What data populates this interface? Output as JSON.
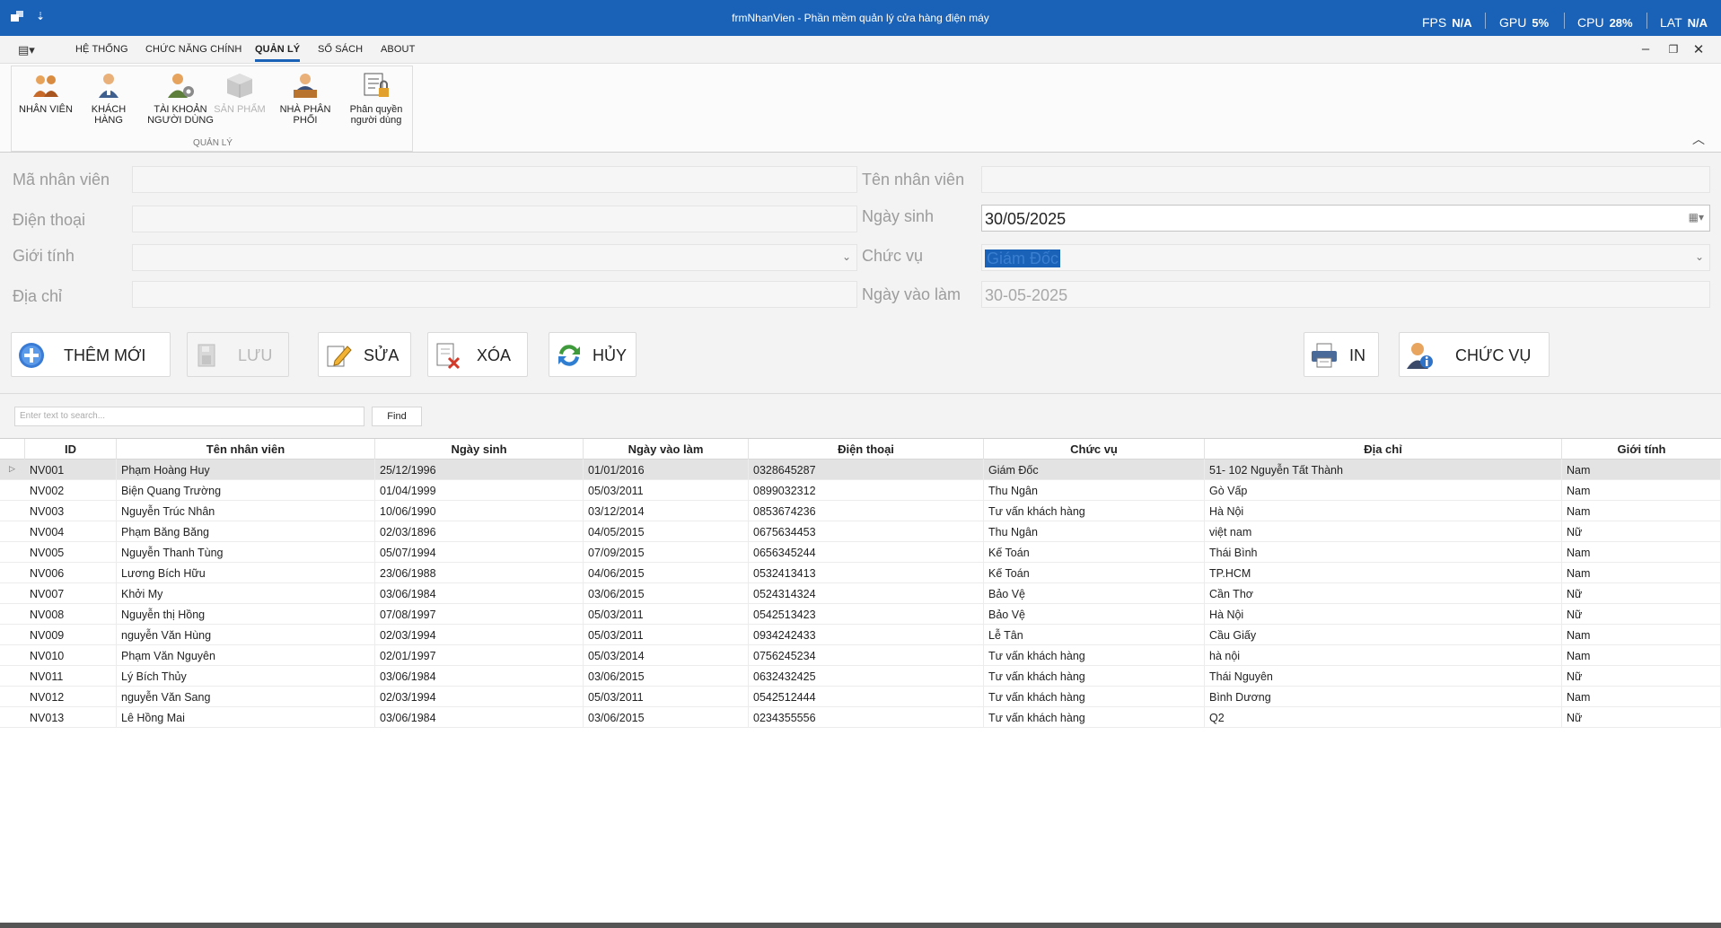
{
  "window": {
    "title": "frmNhanVien - Phần mềm quản lý cửa hàng điện máy",
    "qat_symbol": "⇣"
  },
  "perf": {
    "fps_label": "FPS",
    "fps_value": "N/A",
    "gpu_label": "GPU",
    "gpu_value": "5%",
    "cpu_label": "CPU",
    "cpu_value": "28%",
    "lat_label": "LAT",
    "lat_value": "N/A"
  },
  "menu": {
    "tabs": [
      "HỆ THỐNG",
      "CHỨC NĂNG CHÍNH",
      "QUẢN LÝ",
      "SỔ SÁCH",
      "ABOUT"
    ],
    "active_tab": "QUẢN LÝ"
  },
  "ribbon": {
    "group_label": "QUẢN LÝ",
    "buttons": [
      {
        "label": "NHÂN VIÊN",
        "icon": "staff-group-icon"
      },
      {
        "label": "KHÁCH HÀNG",
        "icon": "customer-icon"
      },
      {
        "label": "TÀI KHOẢN NGƯỜI DÙNG",
        "icon": "user-account-icon"
      },
      {
        "label": "SẢN PHẨM",
        "icon": "product-box-icon",
        "disabled": true
      },
      {
        "label": "NHÀ PHÂN PHỐI",
        "icon": "distributor-icon"
      },
      {
        "label": "Phân quyền người dùng",
        "icon": "permission-icon"
      }
    ]
  },
  "form": {
    "ma_nv_label": "Mã nhân viên",
    "ten_nv_label": "Tên nhân viên",
    "dien_thoai_label": "Điện thoại",
    "ngay_sinh_label": "Ngày sinh",
    "ngay_sinh_value": "30/05/2025",
    "gioi_tinh_label": "Giới tính",
    "chuc_vu_label": "Chức vụ",
    "chuc_vu_value": "Giám Đốc",
    "dia_chi_label": "Địa chỉ",
    "ngay_vao_lam_label": "Ngày vào làm",
    "ngay_vao_lam_value": "30-05-2025"
  },
  "actions": {
    "them_moi": "THÊM MỚI",
    "luu": "LƯU",
    "sua": "SỬA",
    "xoa": "XÓA",
    "huy": "HỦY",
    "in": "IN",
    "chuc_vu": "CHỨC VỤ"
  },
  "find": {
    "placeholder": "Enter text to search...",
    "button": "Find"
  },
  "grid": {
    "columns": [
      "ID",
      "Tên nhân viên",
      "Ngày sinh",
      "Ngày vào làm",
      "Điện thoại",
      "Chức vụ",
      "Địa chỉ",
      "Giới tính"
    ],
    "rows": [
      [
        "NV001",
        "Phạm Hoàng Huy",
        "25/12/1996",
        "01/01/2016",
        "0328645287",
        "Giám Đốc",
        "51- 102 Nguyễn Tất Thành",
        "Nam"
      ],
      [
        "NV002",
        "Biện Quang Trường",
        "01/04/1999",
        "05/03/2011",
        "0899032312",
        "Thu Ngân",
        "Gò Vấp",
        "Nam"
      ],
      [
        "NV003",
        "Nguyễn Trúc Nhân",
        "10/06/1990",
        "03/12/2014",
        "0853674236",
        "Tư vấn khách hàng",
        "Hà Nội",
        "Nam"
      ],
      [
        "NV004",
        "Phạm Băng Băng",
        "02/03/1896",
        "04/05/2015",
        "0675634453",
        "Thu Ngân",
        "việt nam",
        "Nữ"
      ],
      [
        "NV005",
        "Nguyễn Thanh Tùng",
        "05/07/1994",
        "07/09/2015",
        "0656345244",
        "Kế Toán",
        "Thái Bình",
        "Nam"
      ],
      [
        "NV006",
        "Lương Bích Hữu",
        "23/06/1988",
        "04/06/2015",
        "0532413413",
        "Kế Toán",
        "TP.HCM",
        "Nam"
      ],
      [
        "NV007",
        "Khởi My",
        "03/06/1984",
        "03/06/2015",
        "0524314324",
        "Bảo Vệ",
        "Cần Thơ",
        "Nữ"
      ],
      [
        "NV008",
        "Nguyễn thị Hồng",
        "07/08/1997",
        "05/03/2011",
        "0542513423",
        "Bảo Vệ",
        "Hà Nội",
        "Nữ"
      ],
      [
        "NV009",
        "nguyễn Văn Hùng",
        "02/03/1994",
        "05/03/2011",
        "0934242433",
        "Lễ Tân",
        "Cầu Giấy",
        "Nam"
      ],
      [
        "NV010",
        "Phạm Văn Nguyên",
        "02/01/1997",
        "05/03/2014",
        "0756245234",
        "Tư vấn khách hàng",
        "hà nội",
        "Nam"
      ],
      [
        "NV011",
        "Lý Bích Thủy",
        "03/06/1984",
        "03/06/2015",
        "0632432425",
        "Tư vấn khách hàng",
        "Thái Nguyên",
        "Nữ"
      ],
      [
        "NV012",
        "nguyễn Văn Sang",
        "02/03/1994",
        "05/03/2011",
        "0542512444",
        "Tư vấn khách hàng",
        "Bình Dương",
        "Nam"
      ],
      [
        "NV013",
        "Lê Hồng Mai",
        "03/06/1984",
        "03/06/2015",
        "0234355556",
        "Tư vấn khách hàng",
        "Q2",
        "Nữ"
      ]
    ]
  },
  "colors": {
    "title_bar": "#1a62b7",
    "accent": "#1a62b7"
  }
}
